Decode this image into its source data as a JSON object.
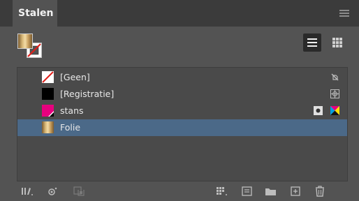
{
  "panel": {
    "tab_title": "Stalen",
    "menu_icon": "panel-menu-icon"
  },
  "toolbar": {
    "fill_stroke": {
      "fill": "Folie gradient",
      "stroke": "None"
    },
    "view_modes": [
      "list-view-icon",
      "grid-view-icon"
    ],
    "active_view": "list"
  },
  "swatches": [
    {
      "label": "[Geen]",
      "type": "none",
      "right_icons": [
        "not-editable-icon"
      ]
    },
    {
      "label": "[Registratie]",
      "type": "registration",
      "color": "#000000",
      "right_icons": [
        "registration-icon"
      ]
    },
    {
      "label": "stans",
      "type": "spot",
      "color": "#e6007e",
      "right_icons": [
        "spot-color-icon",
        "cmyk-mode-icon"
      ]
    },
    {
      "label": "Folie",
      "type": "gradient",
      "selected": true,
      "right_icons": []
    }
  ],
  "bottom_toolbar": [
    "swatch-libraries-icon",
    "show-kinds-icon",
    "new-group-icon",
    "swatch-views-icon",
    "new-color-group-icon",
    "folder-icon",
    "new-swatch-icon",
    "delete-swatch-icon"
  ]
}
